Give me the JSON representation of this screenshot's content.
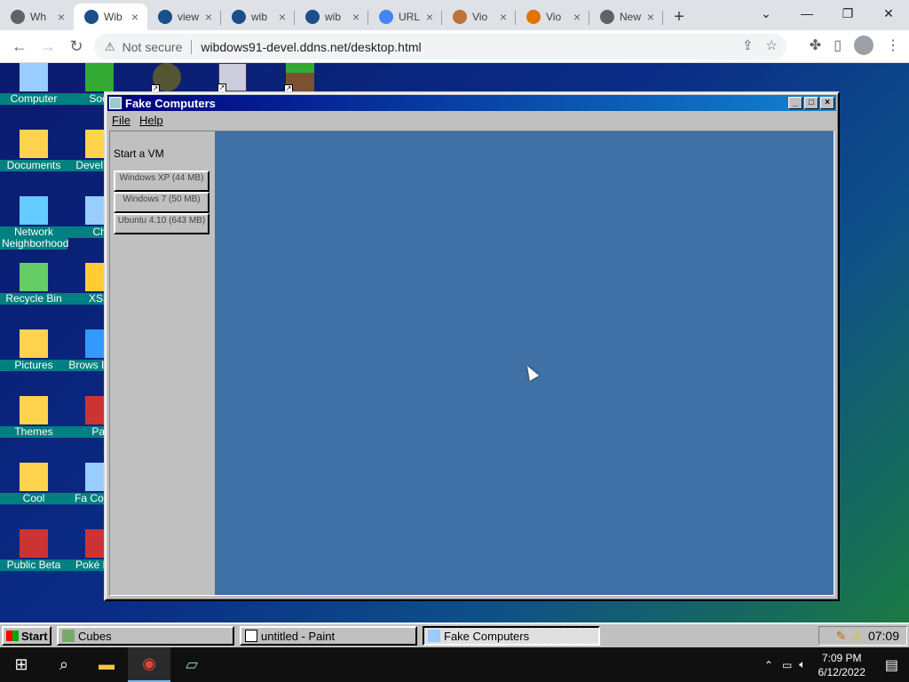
{
  "browser": {
    "tabs": [
      {
        "title": "Wh",
        "color": "#5f6368"
      },
      {
        "title": "Wib",
        "color": "#1a4f8a"
      },
      {
        "title": "view",
        "color": "#1a4f8a"
      },
      {
        "title": "wib",
        "color": "#1a4f8a"
      },
      {
        "title": "wib",
        "color": "#1a4f8a"
      },
      {
        "title": "URL",
        "color": "#4285f4"
      },
      {
        "title": "Vio",
        "color": "#c0703a"
      },
      {
        "title": "Vio",
        "color": "#e37400"
      },
      {
        "title": "New Ta",
        "color": "#5f6368"
      }
    ],
    "not_secure": "Not secure",
    "url": "wibdows91-devel.ddns.net/desktop.html"
  },
  "desktop": {
    "icons": [
      {
        "label": "Computer",
        "color": "#9cf"
      },
      {
        "label": "Docu­ments",
        "color": "#ffd34d"
      },
      {
        "label": "Network Neighborhood",
        "color": "#6cf"
      },
      {
        "label": "Recycle Bin",
        "color": "#6c6"
      },
      {
        "label": "Pictures",
        "color": "#ffd34d"
      },
      {
        "label": "Themes",
        "color": "#ffd34d"
      },
      {
        "label": "Cool",
        "color": "#ffd34d"
      },
      {
        "label": "Public Beta",
        "color": "#c33"
      }
    ],
    "icons2": [
      {
        "label": "Soci",
        "color": "#3a3"
      },
      {
        "label": "Devel Inst",
        "color": "#ffd34d"
      },
      {
        "label": "Ch",
        "color": "#9cf"
      },
      {
        "label": "XSS",
        "color": "#fc3"
      },
      {
        "label": "Brows Interw",
        "color": "#39f"
      },
      {
        "label": "Pai",
        "color": "#c33"
      },
      {
        "label": "Fa Compu",
        "color": "#9cf"
      },
      {
        "label": "Poké Plati",
        "color": "#c33"
      }
    ]
  },
  "window": {
    "title": "Fake Computers",
    "menu": [
      "File",
      "Help"
    ],
    "sidebar_heading": "Start a VM",
    "vm_buttons": [
      "Windows XP (44 MB)",
      "Windows 7 (50 MB)",
      "Ubuntu 4.10 (643 MB)"
    ]
  },
  "taskbar95": {
    "start": "Start",
    "tasks": [
      "Cubes",
      "untitled - Paint",
      "Fake Computers"
    ],
    "clock": "07:09"
  },
  "taskbar10": {
    "time": "7:09 PM",
    "date": "6/12/2022"
  }
}
